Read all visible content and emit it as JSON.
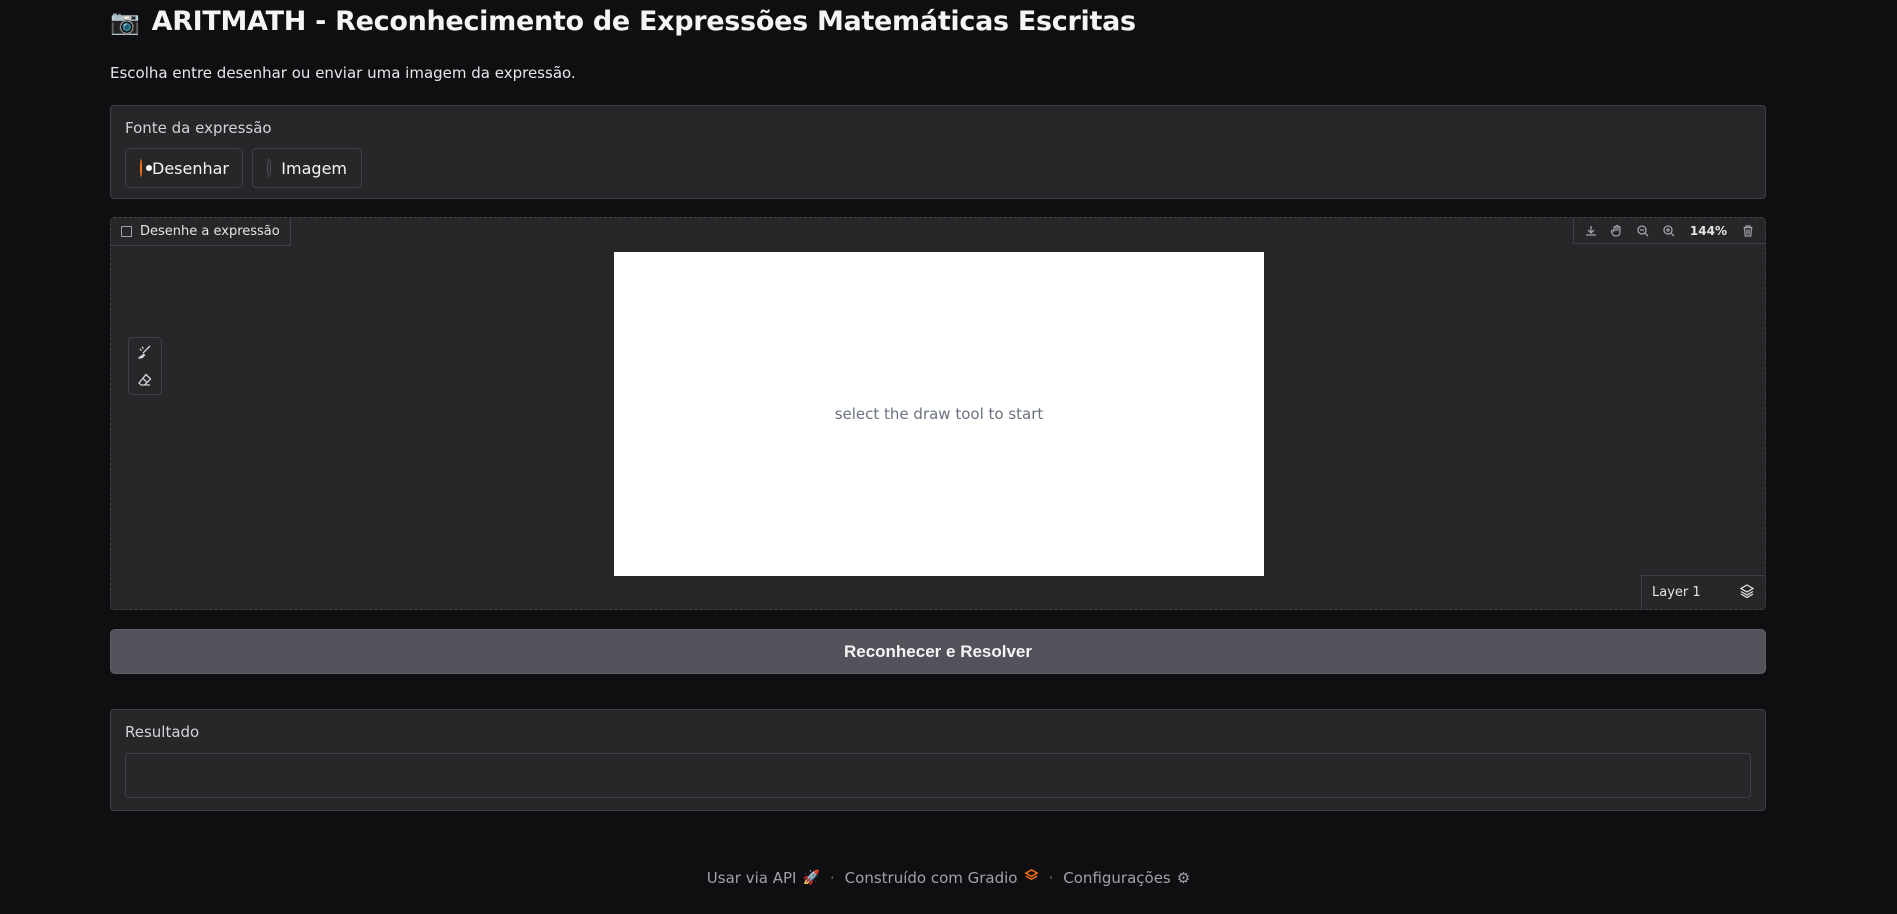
{
  "header": {
    "icon": "camera-icon",
    "title": "ARITMATH - Reconhecimento de Expressões Matemáticas Escritas",
    "subtitle": "Escolha entre desenhar ou enviar uma imagem da expressão."
  },
  "source": {
    "label": "Fonte da expressão",
    "options": [
      {
        "label": "Desenhar",
        "selected": true
      },
      {
        "label": "Imagem",
        "selected": false
      }
    ]
  },
  "canvas": {
    "label": "Desenhe a expressão",
    "zoom": "144%",
    "hint": "select the draw tool to start",
    "layer": "Layer 1",
    "toolbar": [
      "download-icon",
      "hand-pan-icon",
      "zoom-out-icon",
      "zoom-in-icon",
      "trash-icon"
    ],
    "tools": [
      "brush-icon",
      "eraser-icon"
    ]
  },
  "actions": {
    "submit_label": "Reconhecer e Resolver"
  },
  "result": {
    "label": "Resultado",
    "value": ""
  },
  "footer": {
    "api_label": "Usar via API",
    "built_label": "Construído com Gradio",
    "settings_label": "Configurações",
    "separator": "·"
  },
  "colors": {
    "accent": "#f97316",
    "background": "#0f0f11",
    "panel": "#27272a",
    "button": "#52525b"
  }
}
